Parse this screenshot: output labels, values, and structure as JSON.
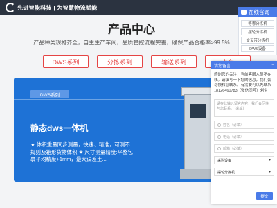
{
  "header": {
    "logo_text": "先进智能科技 | 为智慧物流赋能"
  },
  "hero": {
    "title": "产品中心",
    "subtitle": "产品种类规格齐全，自主生产车间，品质管控流程完善，确保产品合格率>99.5%"
  },
  "tabs": [
    "DWS系列",
    "分拣系列",
    "输送系列",
    "卡车"
  ],
  "card": {
    "badge": "DWS系列",
    "title": "静态dws一体机",
    "desc": "★ 体积重量同步测量，快速、精准，可测不规则及箱形货物体积 ★ 尺寸测量精度:平整包裹平均精度+1mm，最大误差土..."
  },
  "widget": {
    "online_label": "在线咨询",
    "services": [
      "等哪分拣机",
      "摆轮分拣机",
      "交叉带分拣机",
      "DWS设备"
    ]
  },
  "message": {
    "header": "请您留言",
    "intro": "感谢您的关注，当前客服人员不在线。请填写一下您的信息，我们会尽快和您联系。有需要可以先联系18126460783（微信同号）刘生",
    "textarea_placeholder": "请在此输入留言内容，我们会尽快与您联系。（必填）",
    "fields": [
      "姓名（必填）",
      "电话（必填）",
      "邮箱（必填）"
    ],
    "select1": "采购设备",
    "select2": "摆轮分拣机",
    "submit": "提交"
  },
  "colors": {
    "accent": "#4a7be8",
    "tab_red": "#e54545",
    "card_blue": "#1e72d6"
  }
}
